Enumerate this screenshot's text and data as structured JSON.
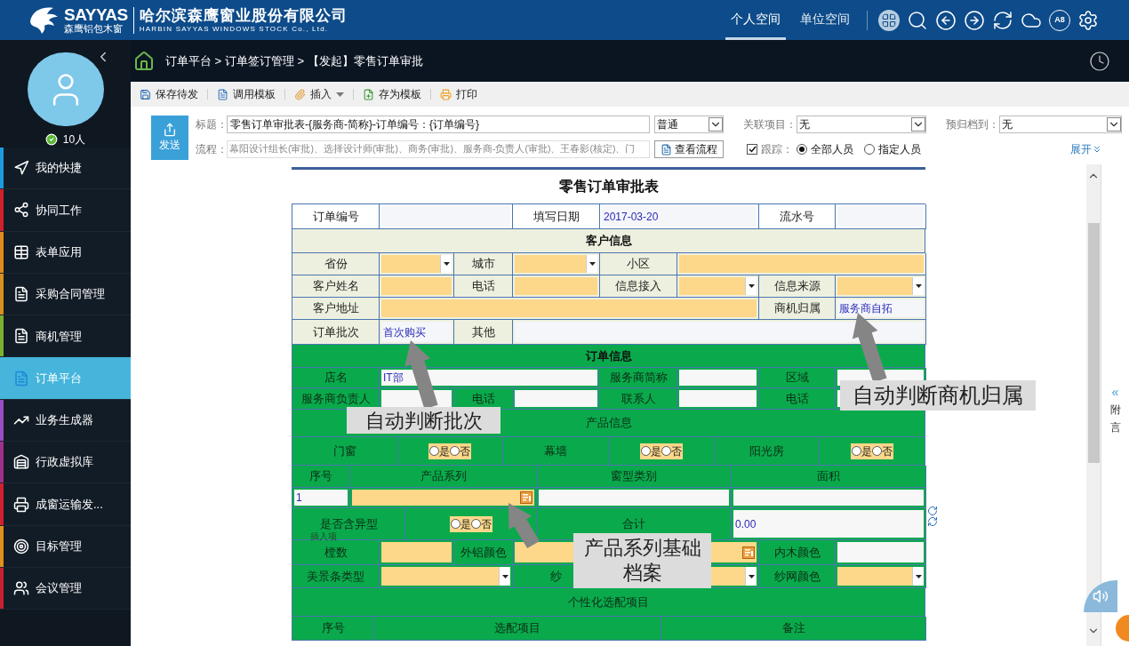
{
  "header": {
    "brand": "SAYYAS",
    "brand_sub": "森鹰铝包木窗",
    "company": "哈尔滨森鹰窗业股份有限公司",
    "company_en": "HARBIN SAYYAS WINDOWS STOCK Co., Ltd.",
    "tabs": [
      {
        "label": "个人空间",
        "selected": true
      },
      {
        "label": "单位空间",
        "selected": false
      }
    ],
    "app_badge": "A8"
  },
  "sidebar": {
    "online": "10人",
    "items": [
      {
        "label": "我的快捷",
        "color": "#1e9be0",
        "selected": false
      },
      {
        "label": "协同工作",
        "color": "#d0202a",
        "selected": false
      },
      {
        "label": "表单应用",
        "color": "#e08a1a",
        "selected": false
      },
      {
        "label": "采购合同管理",
        "color": "#d8901c",
        "selected": false
      },
      {
        "label": "商机管理",
        "color": "#7ab030",
        "selected": false
      },
      {
        "label": "订单平台",
        "color": "#45b5dc",
        "selected": true
      },
      {
        "label": "业务生成器",
        "color": "#9a4cc0",
        "selected": false
      },
      {
        "label": "行政虚拟库",
        "color": "#a0308a",
        "selected": false
      },
      {
        "label": "成窗运输发...",
        "color": "#d02030",
        "selected": false
      },
      {
        "label": "目标管理",
        "color": "#e0901a",
        "selected": false
      },
      {
        "label": "会议管理",
        "color": "#c82030",
        "selected": false
      }
    ]
  },
  "breadcrumb": "订单平台 > 订单签订管理 > 【发起】零售订单审批",
  "toolbar": [
    {
      "label": "保存待发",
      "menu": false
    },
    {
      "label": "调用模板",
      "menu": false
    },
    {
      "label": "插入",
      "menu": true
    },
    {
      "label": "存为模板",
      "menu": false
    },
    {
      "label": "打印",
      "menu": false
    }
  ],
  "send_button": "发送",
  "title_field": {
    "label": "标题：",
    "value": "零售订单审批表-{服务商-简称}-订单编号：{订单编号}"
  },
  "priority": "普通",
  "related": {
    "label": "关联项目：",
    "value": "无"
  },
  "archive": {
    "label": "预归档到：",
    "value": "无"
  },
  "flow_field": {
    "label": "流程：",
    "value": "幕阳设计组长(审批)、选择设计师(审批)、商务(审批)、服务商-负责人(审批)、王春影(核定)、门"
  },
  "view_flow": "查看流程",
  "track": {
    "label": "跟踪：",
    "checked": true,
    "options": [
      {
        "label": "全部人员",
        "selected": true
      },
      {
        "label": "指定人员",
        "selected": false
      }
    ]
  },
  "expand": "展开",
  "side_tab": {
    "arrow": "«",
    "label": "附言"
  },
  "form": {
    "title": "零售订单审批表",
    "sections": [
      {
        "kind": "plain",
        "rows": [
          {
            "fields": [
              {
                "kind": "label",
                "text": "订单编号"
              },
              {
                "kind": "input",
                "required": false
              },
              {
                "kind": "label",
                "text": "填写日期"
              },
              {
                "kind": "input",
                "required": false,
                "value": "2017-03-20"
              },
              {
                "kind": "label",
                "text": "流水号"
              },
              {
                "kind": "input",
                "required": false
              }
            ]
          }
        ]
      },
      {
        "kind": "customer",
        "heading": "客户信息",
        "rows": [
          {
            "fields": [
              {
                "kind": "label",
                "text": "省份"
              },
              {
                "kind": "select",
                "required": true
              },
              {
                "kind": "label",
                "text": "城市"
              },
              {
                "kind": "select",
                "required": true
              },
              {
                "kind": "label",
                "text": "小区"
              },
              {
                "kind": "input",
                "required": true
              }
            ]
          },
          {
            "fields": [
              {
                "kind": "label",
                "text": "客户姓名"
              },
              {
                "kind": "input",
                "required": true
              },
              {
                "kind": "label",
                "text": "电话"
              },
              {
                "kind": "input",
                "required": true
              },
              {
                "kind": "label",
                "text": "信息接入"
              },
              {
                "kind": "select",
                "required": true
              },
              {
                "kind": "label",
                "text": "信息来源"
              },
              {
                "kind": "select",
                "required": true
              }
            ]
          },
          {
            "fields": [
              {
                "kind": "label",
                "text": "客户地址"
              },
              {
                "kind": "input",
                "required": true
              },
              {
                "kind": "label",
                "text": "商机归属"
              },
              {
                "kind": "input",
                "required": false,
                "value": "服务商自拓"
              }
            ]
          },
          {
            "fields": [
              {
                "kind": "label",
                "text": "订单批次"
              },
              {
                "kind": "input",
                "required": false,
                "value": "首次购买"
              },
              {
                "kind": "label",
                "text": "其他"
              },
              {
                "kind": "input",
                "required": false
              }
            ]
          }
        ]
      },
      {
        "kind": "order",
        "heading": "订单信息",
        "rows": [
          {
            "fields": [
              {
                "kind": "label",
                "text": "店名"
              },
              {
                "kind": "input",
                "required": false,
                "value": "IT部"
              },
              {
                "kind": "label",
                "text": "服务商简称"
              },
              {
                "kind": "input",
                "required": false
              },
              {
                "kind": "label",
                "text": "区域"
              },
              {
                "kind": "input",
                "required": false
              }
            ]
          },
          {
            "fields": [
              {
                "kind": "label",
                "text": "服务商负责人"
              },
              {
                "kind": "input",
                "required": false
              },
              {
                "kind": "label",
                "text": "电话"
              },
              {
                "kind": "input",
                "required": false
              },
              {
                "kind": "label",
                "text": "联系人"
              },
              {
                "kind": "input",
                "required": false
              },
              {
                "kind": "label",
                "text": "电话"
              },
              {
                "kind": "input",
                "required": false
              }
            ]
          },
          {
            "heading": "产品信息"
          },
          {
            "fields": [
              {
                "kind": "label",
                "text": "门窗"
              },
              {
                "kind": "radio",
                "options": [
                  {
                    "label": "是",
                    "selected": false
                  },
                  {
                    "label": "否",
                    "selected": false
                  }
                ]
              },
              {
                "kind": "label",
                "text": "幕墙"
              },
              {
                "kind": "radio",
                "options": [
                  {
                    "label": "是",
                    "selected": false
                  },
                  {
                    "label": "否",
                    "selected": false
                  }
                ]
              },
              {
                "kind": "label",
                "text": "阳光房"
              },
              {
                "kind": "radio",
                "options": [
                  {
                    "label": "是",
                    "selected": false
                  },
                  {
                    "label": "否",
                    "selected": false
                  }
                ]
              }
            ]
          },
          {
            "fields": [
              {
                "kind": "label",
                "text": "序号"
              },
              {
                "kind": "label",
                "text": "产品系列"
              },
              {
                "kind": "label",
                "text": "窗型类别"
              },
              {
                "kind": "label",
                "text": "面积"
              }
            ]
          },
          {
            "fields": [
              {
                "kind": "input",
                "required": false,
                "value": "1"
              },
              {
                "kind": "lookup",
                "required": true
              },
              {
                "kind": "input",
                "required": false
              },
              {
                "kind": "input",
                "required": false
              }
            ]
          },
          {
            "note": "插入项",
            "fields": [
              {
                "kind": "label",
                "text": "是否含异型"
              },
              {
                "kind": "radio",
                "options": [
                  {
                    "label": "是",
                    "selected": false
                  },
                  {
                    "label": "否",
                    "selected": false
                  }
                ]
              },
              {
                "kind": "label",
                "text": "合计"
              },
              {
                "kind": "input",
                "required": false,
                "value": "0.00"
              }
            ]
          },
          {
            "fields": [
              {
                "kind": "label",
                "text": "樘数"
              },
              {
                "kind": "input",
                "required": true
              },
              {
                "kind": "label",
                "text": "外铝颜色"
              },
              {
                "kind": "lookup",
                "required": true
              },
              {
                "kind": "label",
                "text": "内木颜色"
              },
              {
                "kind": "input",
                "required": false
              }
            ]
          },
          {
            "fields": [
              {
                "kind": "label",
                "text": "美景条类型"
              },
              {
                "kind": "select",
                "required": true
              },
              {
                "kind": "label",
                "text": "纱"
              },
              {
                "kind": "select",
                "required": true
              },
              {
                "kind": "label",
                "text": "纱网颜色"
              },
              {
                "kind": "select",
                "required": true
              }
            ]
          },
          {
            "heading": "个性化选配项目"
          },
          {
            "fields": [
              {
                "kind": "label",
                "text": "序号"
              },
              {
                "kind": "label",
                "text": "选配项目"
              },
              {
                "kind": "label",
                "text": "备注"
              }
            ]
          }
        ]
      }
    ]
  },
  "callouts": [
    {
      "text": "自动判断批次"
    },
    {
      "text": "自动判断商机归属"
    },
    {
      "text": "产品系列基础档案"
    }
  ]
}
